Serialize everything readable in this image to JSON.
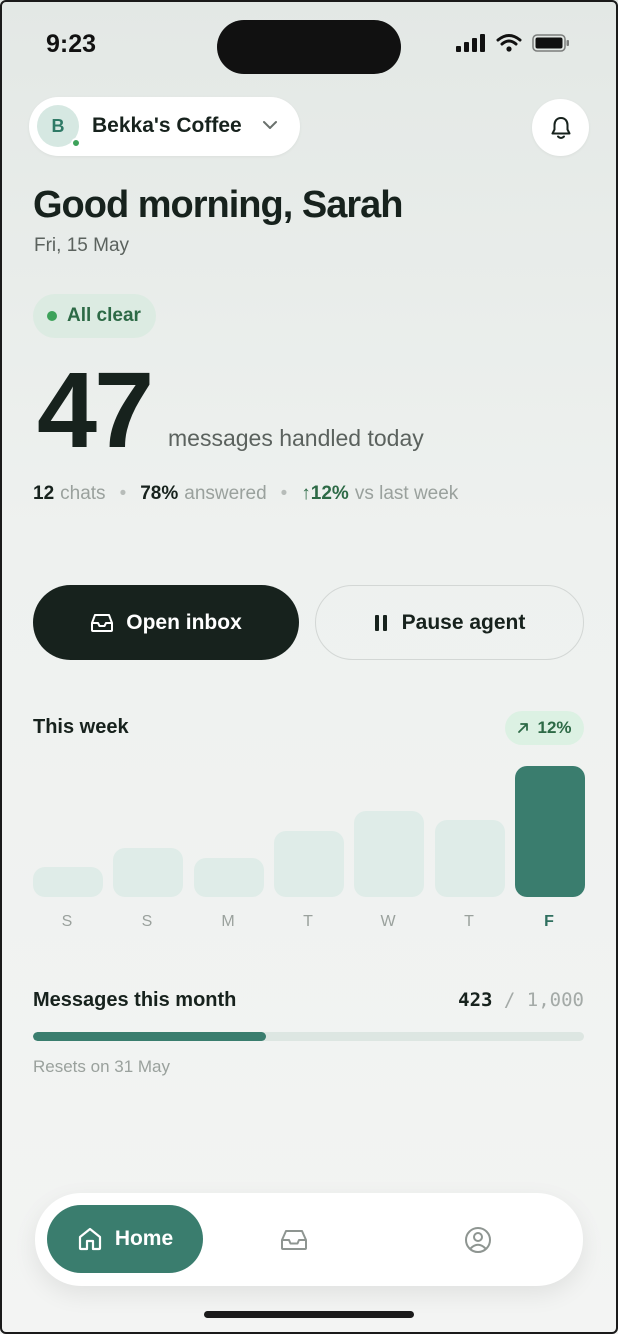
{
  "status_bar": {
    "time": "9:23"
  },
  "header": {
    "business_initial": "B",
    "business_name": "Bekka's Coffee"
  },
  "greeting": "Good morning, Sarah",
  "date": "Fri, 15 May",
  "status_badge": "All clear",
  "hero": {
    "count": "47",
    "caption": "messages handled today"
  },
  "stats": {
    "chats_value": "12",
    "chats_label": "chats",
    "answered_value": "78%",
    "answered_label": "answered",
    "trend_value": "↑12%",
    "trend_label": "vs last week"
  },
  "actions": {
    "open_inbox": "Open inbox",
    "pause_agent": "Pause agent"
  },
  "week": {
    "title": "This week",
    "change": "12%"
  },
  "chart_data": {
    "type": "bar",
    "categories": [
      "S",
      "S",
      "M",
      "T",
      "W",
      "T",
      "F"
    ],
    "values": [
      3,
      5,
      4,
      6.7,
      8.7,
      7.8,
      13.3
    ],
    "highlight_index": 6,
    "colors": {
      "inactive": "#dfece8",
      "active": "#3a7d6e"
    },
    "title": "This week",
    "grid": false
  },
  "month": {
    "title": "Messages this month",
    "used": "423",
    "limit": "/ 1,000",
    "progress_fraction": 0.423,
    "resets": "Resets on 31 May"
  },
  "nav": {
    "home": "Home"
  },
  "colors": {
    "accent": "#3a7d6e",
    "dark": "#17221d",
    "positive": "#2d6a46",
    "badge_bg": "#dcebe2"
  }
}
